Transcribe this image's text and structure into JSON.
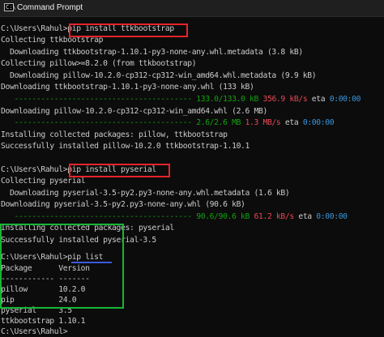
{
  "window": {
    "title": "Command Prompt",
    "icon": "cmd-icon"
  },
  "colors": {
    "prompt_highlight": "#e8232a",
    "list_highlight": "#17b634",
    "underline": "#3b5bdb",
    "progress": "#13a10e",
    "speed": "#e74856",
    "eta": "#3a96dd"
  },
  "console": {
    "l1_prompt": "C:\\Users\\Rahul>",
    "l1_cmd": "pip install ttkbootstrap",
    "l2": "Collecting ttkbootstrap",
    "l3": "  Downloading ttkbootstrap-1.10.1-py3-none-any.whl.metadata (3.8 kB)",
    "l4": "Collecting pillow>=8.2.0 (from ttkbootstrap)",
    "l5": "  Downloading pillow-10.2.0-cp312-cp312-win_amd64.whl.metadata (9.9 kB)",
    "l6": "Downloading ttkbootstrap-1.10.1-py3-none-any.whl (133 kB)",
    "l7_bar": "   ----------------------------------------",
    "l7_size": "133.0/133.0 kB",
    "l7_speed": "356.9 kB/s",
    "l7_eta_label": "eta",
    "l7_eta": "0:00:00",
    "l8": "Downloading pillow-10.2.0-cp312-cp312-win_amd64.whl (2.6 MB)",
    "l9_bar": "   ----------------------------------------",
    "l9_size": "2.6/2.6 MB",
    "l9_speed": "1.3 MB/s",
    "l9_eta_label": "eta",
    "l9_eta": "0:00:00",
    "l10": "Installing collected packages: pillow, ttkbootstrap",
    "l11": "Successfully installed pillow-10.2.0 ttkbootstrap-1.10.1",
    "l13_prompt": "C:\\Users\\Rahul>",
    "l13_cmd": "pip install pyserial",
    "l14": "Collecting pyserial",
    "l15": "  Downloading pyserial-3.5-py2.py3-none-any.whl.metadata (1.6 kB)",
    "l16": "Downloading pyserial-3.5-py2.py3-none-any.whl (90.6 kB)",
    "l17_bar": "   ----------------------------------------",
    "l17_size": "90.6/90.6 kB",
    "l17_speed": "61.2 kB/s",
    "l17_eta_label": "eta",
    "l17_eta": "0:00:00",
    "l18": "Installing collected packages: pyserial",
    "l19": "Successfully installed pyserial-3.5",
    "l21_prompt": "C:\\Users\\Rahul>",
    "l21_cmd": "pip list",
    "l22": "Package      Version",
    "l23": "------------ -------",
    "l24": "pillow       10.2.0",
    "l25": "pip          24.0",
    "l26": "pyserial     3.5",
    "l27": "ttkbootstrap 1.10.1",
    "l29_prompt": "C:\\Users\\Rahul>"
  }
}
